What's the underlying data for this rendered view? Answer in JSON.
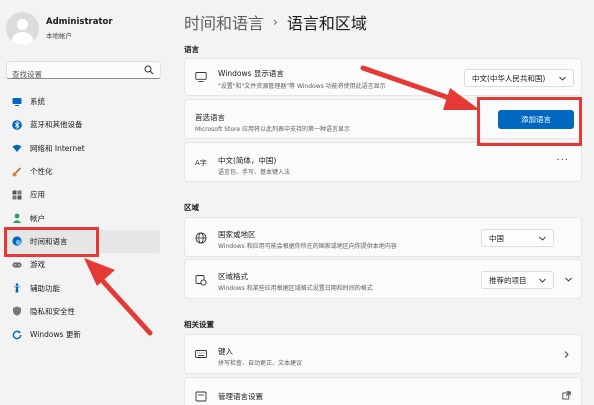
{
  "user": {
    "name": "Administrator",
    "account_type": "本地帐户"
  },
  "search": {
    "placeholder": "查找设置"
  },
  "nav": [
    {
      "label": "系统",
      "icon": "monitor-icon",
      "color": "#0067c0"
    },
    {
      "label": "蓝牙和其他设备",
      "icon": "bluetooth-icon",
      "color": "#0067c0"
    },
    {
      "label": "网络和 Internet",
      "icon": "wifi-icon",
      "color": "#0067c0"
    },
    {
      "label": "个性化",
      "icon": "brush-icon",
      "color": "#d08a3a"
    },
    {
      "label": "应用",
      "icon": "apps-icon",
      "color": "#555555"
    },
    {
      "label": "帐户",
      "icon": "person-icon",
      "color": "#2a9d5c"
    },
    {
      "label": "时间和语言",
      "icon": "globe-clock-icon",
      "color": "#0067c0",
      "active": true
    },
    {
      "label": "游戏",
      "icon": "gamepad-icon",
      "color": "#666666"
    },
    {
      "label": "辅助功能",
      "icon": "accessibility-icon",
      "color": "#0067c0"
    },
    {
      "label": "隐私和安全性",
      "icon": "shield-icon",
      "color": "#666666"
    },
    {
      "label": "Windows 更新",
      "icon": "update-icon",
      "color": "#0067c0"
    }
  ],
  "breadcrumb": {
    "parent": "时间和语言",
    "separator": "›",
    "current": "语言和区域"
  },
  "language_section": {
    "title": "语言",
    "display_language": {
      "title": "Windows 显示语言",
      "subtitle": "\"设置\"和\"文件资源管理器\"等 Windows 功能将使用此语言显示",
      "value": "中文(中华人民共和国)"
    },
    "preferred": {
      "title": "首选语言",
      "subtitle": "Microsoft Store 应用将以此列表中支持的第一种语言显示",
      "button_label": "添加语言"
    },
    "chinese": {
      "icon_label": "A字",
      "title": "中文(简体，中国)",
      "subtitle": "语言包、手写、基本键入法",
      "more": "···"
    }
  },
  "region_section": {
    "title": "区域",
    "country": {
      "title": "国家或地区",
      "subtitle": "Windows 和应用可能会根据你所在的国家或地区向你提供本地内容",
      "value": "中国"
    },
    "format": {
      "title": "区域格式",
      "subtitle": "Windows 和某些应用根据区域格式设置日期和时间的格式",
      "value": "推荐的项目"
    }
  },
  "related_section": {
    "title": "相关设置",
    "typing": {
      "title": "键入",
      "subtitle": "拼写检查、自动更正、文本建议"
    },
    "manage": {
      "title": "管理语言设置"
    }
  },
  "colors": {
    "accent": "#0067c0",
    "annotation": "#e53935"
  }
}
